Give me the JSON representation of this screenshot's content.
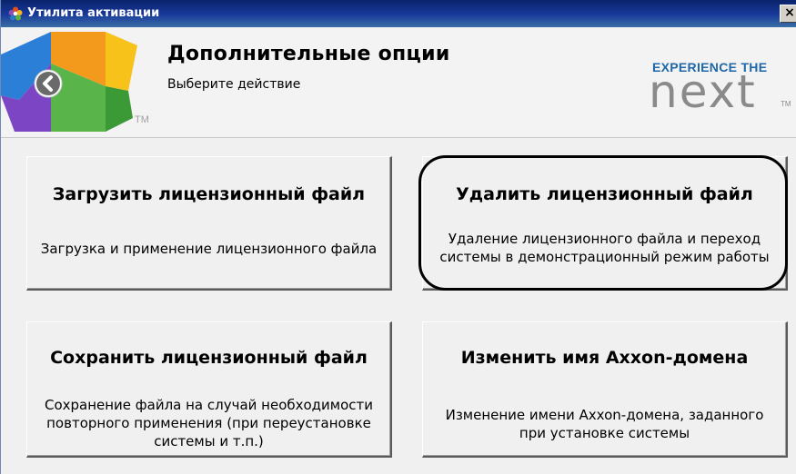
{
  "window": {
    "title": "Утилита активации",
    "close_label": "×"
  },
  "header": {
    "title": "Дополнительные опции",
    "subtitle": "Выберите действие",
    "logo_tm": "TM",
    "brand_line1": "EXPERIENCE THE",
    "brand_line2": "next",
    "brand_tm": "TM"
  },
  "options": [
    {
      "title": "Загрузить лицензионный файл",
      "description": "Загрузка и применение лицензионного файла"
    },
    {
      "title": "Удалить лицензионный файл",
      "description": "Удаление лицензионного файла и переход системы в демонстрационный режим работы"
    },
    {
      "title": "Сохранить лицензионный файл",
      "description": "Сохранение файла на случай необходимости повторного применения (при переустановке системы и т.п.)"
    },
    {
      "title": "Изменить имя Axxon-домена",
      "description": "Изменение имени Axxon-домена, заданного при установке системы"
    }
  ],
  "colors": {
    "titlebar": "#0a246a",
    "brand_blue": "#1f67a8",
    "highlight_outline": "#000000"
  },
  "icons": {
    "title_icon": "app-flower-icon",
    "back": "back-arrow-icon",
    "close": "close-icon"
  }
}
